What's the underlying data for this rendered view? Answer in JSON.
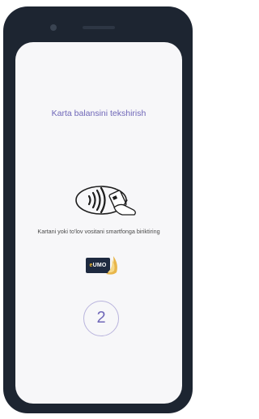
{
  "screen": {
    "title": "Karta balansini tekshirish",
    "caption": "Kartani yoki to'lov vositani smartfonga biriktiring",
    "step_number": "2"
  },
  "logo": {
    "prefix": "e",
    "text": "UMO"
  },
  "icons": {
    "contactless": "contactless-card-tap-icon",
    "brand": "humo-logo"
  },
  "colors": {
    "accent": "#6f67b8",
    "phone_body": "#1d2531",
    "screen_bg": "#f7f7f9",
    "step_circle": "#b9b4dd"
  }
}
